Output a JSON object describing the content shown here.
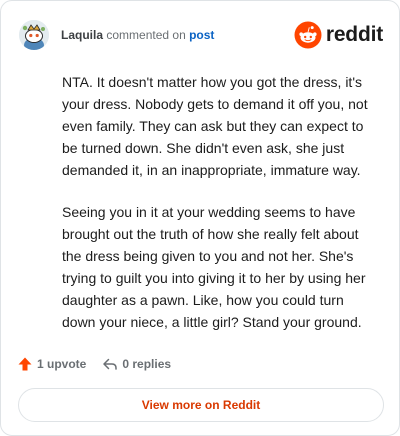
{
  "header": {
    "username": "Laquila",
    "action_text": "commented on",
    "link_text": "post",
    "brand_text": "reddit",
    "brand_color": "#ff4500",
    "avatar_icon": "snoo-avatar",
    "logo_icon": "reddit-alien-icon"
  },
  "comment": {
    "paragraphs": [
      "NTA. It doesn't matter how you got the dress, it's your dress. Nobody gets to demand it off you, not even family. They can ask but they can expect to be turned down. She didn't even ask, she just demanded it, in an inappropriate, immature way.",
      "Seeing you in it at your wedding seems to have brought out the truth of how she really felt about the dress being given to you and not her. She's trying to guilt you into giving it to her by using her daughter as a pawn. Like, how you could turn down your niece, a little girl? Stand your ground."
    ]
  },
  "actions": {
    "upvote_label": "1 upvote",
    "upvote_icon": "upvote-arrow-icon",
    "upvote_color": "#ff4500",
    "replies_label": "0 replies",
    "replies_icon": "reply-arrow-icon"
  },
  "footer": {
    "view_more_label": "View more on Reddit",
    "accent_color": "#d93900"
  }
}
